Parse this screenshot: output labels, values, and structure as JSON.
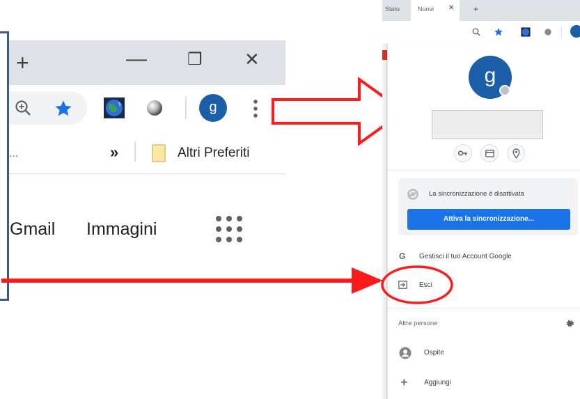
{
  "left_browser": {
    "new_tab_glyph": "+",
    "minimize_glyph": "—",
    "maximize_glyph": "❐",
    "close_glyph": "✕",
    "bookmarks_overflow": "»",
    "bookmarks_left_ellipsis": "...",
    "other_bookmarks_label": "Altri Preferiti",
    "profile_initial": "g",
    "page_links": [
      "Gmail",
      "Immagini"
    ]
  },
  "right_browser": {
    "tabs": [
      "Statu",
      "Nuovi"
    ],
    "profile_initial": "g",
    "profile_popup": {
      "avatar_initial": "g",
      "sync_status": "La sincronizzazione è disattivata",
      "sync_button": "Attiva la sincronizzazione...",
      "manage_account": "Gestisci il tuo Account Google",
      "sign_out": "Esci",
      "other_people_header": "Altre persone",
      "guest": "Ospite",
      "add": "Aggiungi"
    }
  },
  "annotations": {
    "arrow_color": "#ff0000",
    "highlight_color": "#ff0000"
  }
}
